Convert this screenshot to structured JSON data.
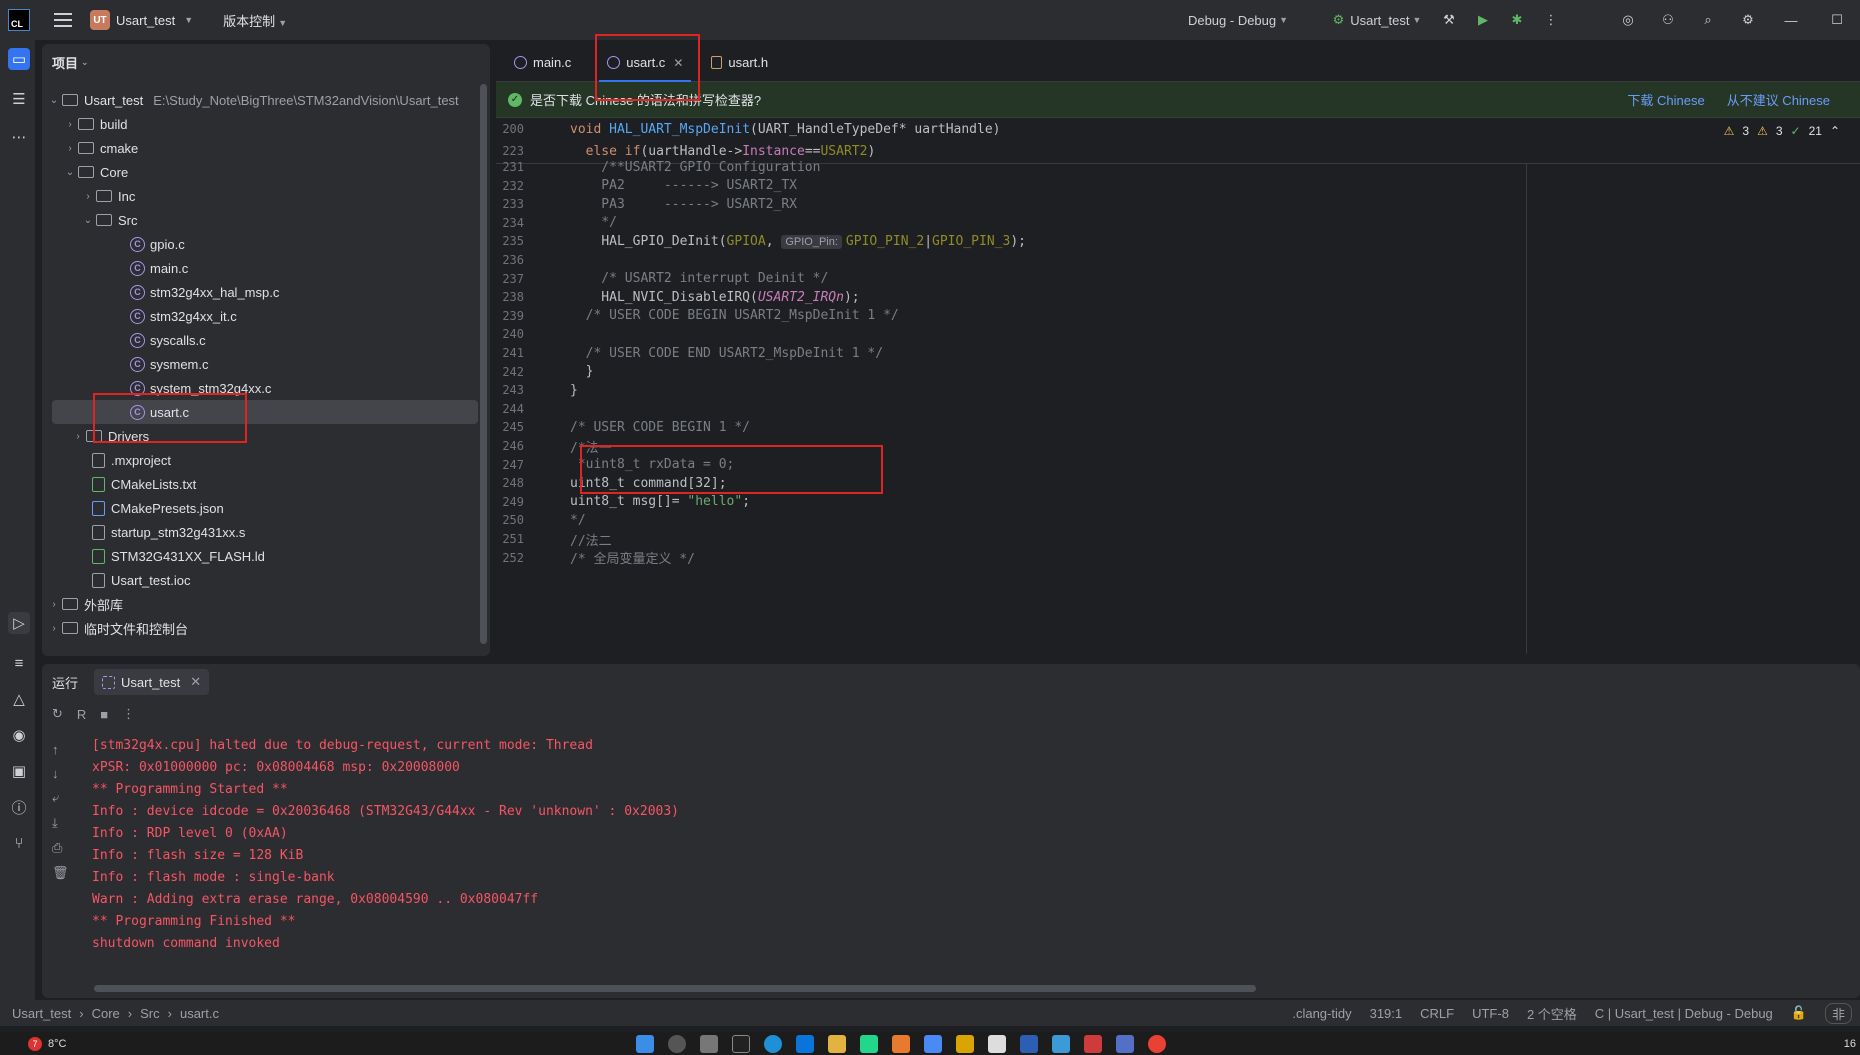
{
  "titlebar": {
    "logo": "CL",
    "project_badge": "UT",
    "project_name": "Usart_test",
    "vcs_label": "版本控制",
    "run_config": "Debug - Debug",
    "target": "Usart_test"
  },
  "project_panel": {
    "title": "项目",
    "root_name": "Usart_test",
    "root_path": "E:\\Study_Note\\BigThree\\STM32andVision\\Usart_test",
    "items": [
      {
        "label": "build"
      },
      {
        "label": "cmake"
      },
      {
        "label": "Core"
      },
      {
        "label": "Inc"
      },
      {
        "label": "Src"
      },
      {
        "label": "gpio.c"
      },
      {
        "label": "main.c"
      },
      {
        "label": "stm32g4xx_hal_msp.c"
      },
      {
        "label": "stm32g4xx_it.c"
      },
      {
        "label": "syscalls.c"
      },
      {
        "label": "sysmem.c"
      },
      {
        "label": "system_stm32g4xx.c"
      },
      {
        "label": "usart.c"
      },
      {
        "label": "Drivers"
      },
      {
        "label": ".mxproject"
      },
      {
        "label": "CMakeLists.txt"
      },
      {
        "label": "CMakePresets.json"
      },
      {
        "label": "startup_stm32g431xx.s"
      },
      {
        "label": "STM32G431XX_FLASH.ld"
      },
      {
        "label": "Usart_test.ioc"
      },
      {
        "label": "外部库"
      },
      {
        "label": "临时文件和控制台"
      }
    ]
  },
  "editor": {
    "tabs": [
      {
        "label": "main.c"
      },
      {
        "label": "usart.c"
      },
      {
        "label": "usart.h"
      }
    ],
    "banner": {
      "text": "是否下载 Chinese 的语法和拼写检查器?",
      "download": "下载 Chinese",
      "decline": "从不建议 Chinese"
    },
    "inspections": {
      "warnings": "3",
      "weak_warnings": "3",
      "ok": "21"
    },
    "sticky": [
      {
        "num": "200",
        "text": "void HAL_UART_MspDeInit(UART_HandleTypeDef* uartHandle)"
      },
      {
        "num": "223",
        "text": "  else if(uartHandle->Instance==USART2)"
      }
    ],
    "lines": [
      {
        "num": "231",
        "text": "    /**USART2 GPIO Configuration"
      },
      {
        "num": "232",
        "text": "    PA2     ------> USART2_TX"
      },
      {
        "num": "233",
        "text": "    PA3     ------> USART2_RX"
      },
      {
        "num": "234",
        "text": "    */"
      },
      {
        "num": "235",
        "text": "    HAL_GPIO_DeInit(GPIOA, GPIO_PIN_2|GPIO_PIN_3);"
      },
      {
        "num": "236",
        "text": ""
      },
      {
        "num": "237",
        "text": "    /* USART2 interrupt Deinit */"
      },
      {
        "num": "238",
        "text": "    HAL_NVIC_DisableIRQ(USART2_IRQn);"
      },
      {
        "num": "239",
        "text": "  /* USER CODE BEGIN USART2_MspDeInit 1 */"
      },
      {
        "num": "240",
        "text": ""
      },
      {
        "num": "241",
        "text": "  /* USER CODE END USART2_MspDeInit 1 */"
      },
      {
        "num": "242",
        "text": "  }"
      },
      {
        "num": "243",
        "text": "}"
      },
      {
        "num": "244",
        "text": ""
      },
      {
        "num": "245",
        "text": "/* USER CODE BEGIN 1 */"
      },
      {
        "num": "246",
        "text": "/*法一"
      },
      {
        "num": "247",
        "text": " *uint8_t rxData = 0;"
      },
      {
        "num": "248",
        "text": "uint8_t command[32];"
      },
      {
        "num": "249",
        "text": "uint8_t msg[]= \"hello\";"
      },
      {
        "num": "250",
        "text": "*/"
      },
      {
        "num": "251",
        "text": "//法二"
      },
      {
        "num": "252",
        "text": "/* 全局变量定义 */"
      }
    ],
    "inlay_hint": "GPIO_Pin:"
  },
  "run_panel": {
    "title": "运行",
    "tab_label": "Usart_test",
    "console": [
      "[stm32g4x.cpu] halted due to debug-request, current mode: Thread",
      "xPSR: 0x01000000 pc: 0x08004468 msp: 0x20008000",
      "** Programming Started **",
      "Info : device idcode = 0x20036468 (STM32G43/G44xx - Rev 'unknown' : 0x2003)",
      "Info : RDP level 0 (0xAA)",
      "Info : flash size = 128 KiB",
      "Info : flash mode : single-bank",
      "Warn : Adding extra erase range, 0x08004590 .. 0x080047ff",
      "** Programming Finished **",
      "shutdown command invoked"
    ]
  },
  "statusbar": {
    "crumbs": [
      "Usart_test",
      "Core",
      "Src",
      "usart.c"
    ],
    "linter": ".clang-tidy",
    "position": "319:1",
    "line_sep": "CRLF",
    "encoding": "UTF-8",
    "indent": "2 个空格",
    "context": "C | Usart_test | Debug - Debug",
    "mode": "非"
  },
  "taskbar": {
    "weather_badge": "7",
    "temperature": "8°C",
    "clock": "16"
  },
  "colors": {
    "accent": "#3574f0",
    "highlight_box": "#e02424",
    "console_text": "#f75464"
  }
}
